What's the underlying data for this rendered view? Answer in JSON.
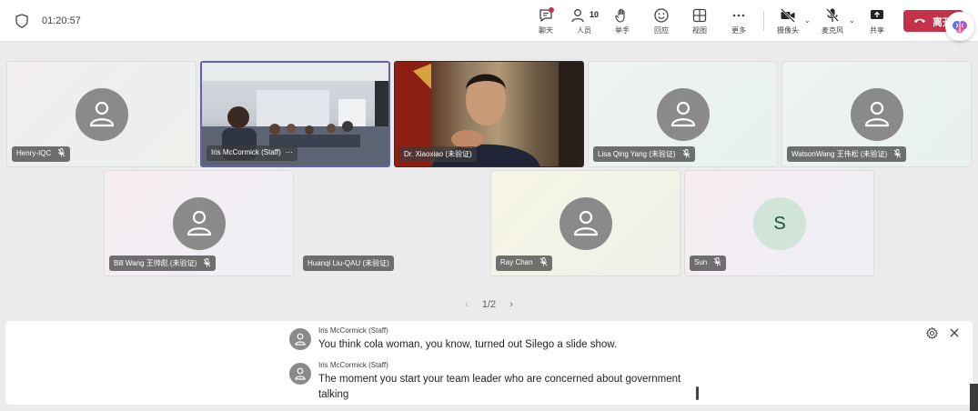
{
  "topbar": {
    "timer": "01:20:57",
    "chat_label": "聊天",
    "people_label": "人员",
    "people_count": "10",
    "raise_label": "举手",
    "react_label": "回应",
    "view_label": "视图",
    "more_label": "更多",
    "camera_label": "摄像头",
    "mic_label": "麦克风",
    "share_label": "共享",
    "leave_label": "离开"
  },
  "tiles": [
    {
      "name": "Henry-IQC",
      "type": "avatar"
    },
    {
      "name": "Iris McCormick (Staff)",
      "type": "video-room"
    },
    {
      "name": "Dr. Xiaoxiao (未验证)",
      "type": "video-person"
    },
    {
      "name": "Lisa Qing Yang (未验证)",
      "type": "avatar"
    },
    {
      "name": "WatsonWang 王伟松 (未验证)",
      "type": "avatar"
    },
    {
      "name": "Bill Wang 王帅彪 (未验证)",
      "type": "avatar"
    },
    {
      "name": "Huanqi Liu-QAU (未验证)",
      "type": "empty"
    },
    {
      "name": "Ray Chan",
      "type": "avatar"
    },
    {
      "name": "Sun",
      "type": "initial",
      "initial": "S"
    }
  ],
  "pager": {
    "label": "1/2"
  },
  "captions": [
    {
      "speaker": "Iris McCormick (Staff)",
      "text": "You think cola woman, you know, turned out Silego a slide show."
    },
    {
      "speaker": "Iris McCormick (Staff)",
      "text": "The moment you start your team leader who are concerned about government talking"
    }
  ],
  "colors": {
    "accent": "#6264a7",
    "leave": "#c4314b",
    "notification": "#c4314b"
  }
}
